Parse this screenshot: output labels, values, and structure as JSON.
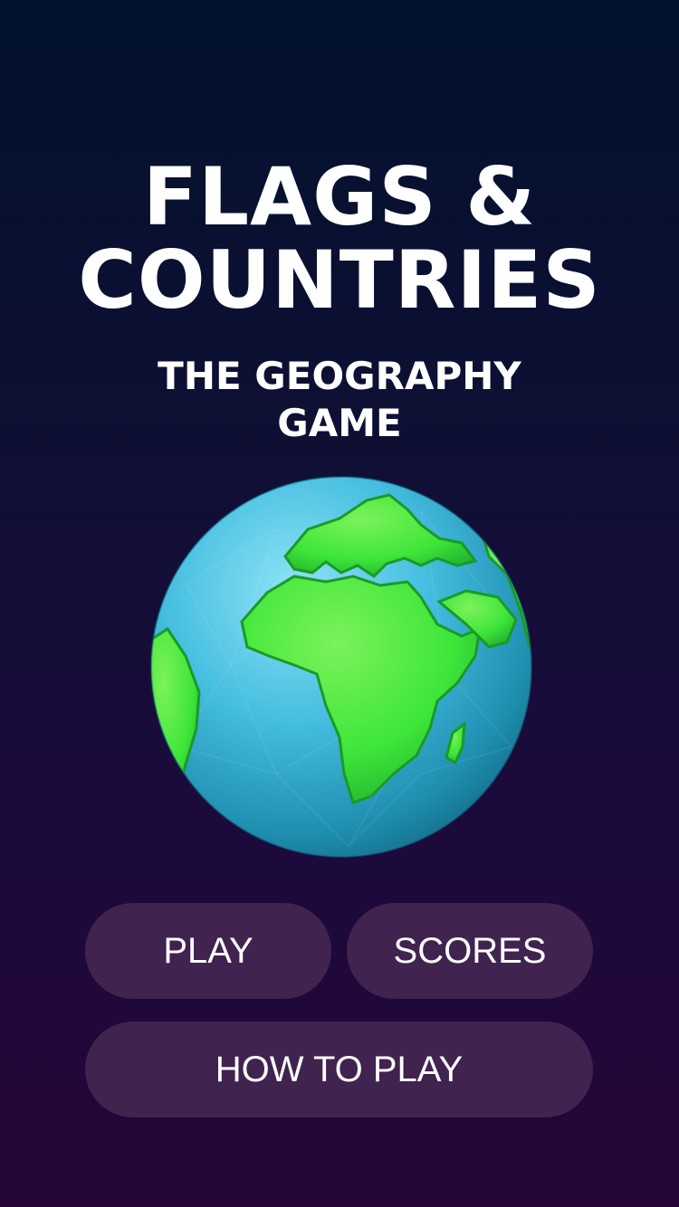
{
  "title": {
    "line1": "FLAGS &",
    "line2": "COUNTRIES"
  },
  "subtitle": {
    "line1": "THE GEOGRAPHY",
    "line2": "GAME"
  },
  "globe": {
    "icon": "globe-icon",
    "ocean_color": "#3fbde0",
    "land_color": "#3ee63a"
  },
  "buttons": {
    "play": "PLAY",
    "scores": "SCORES",
    "how_to_play": "HOW TO PLAY"
  },
  "colors": {
    "background_top": "#02122d",
    "background_bottom": "#250537",
    "button_bg": "#40234f",
    "text": "#ffffff"
  }
}
